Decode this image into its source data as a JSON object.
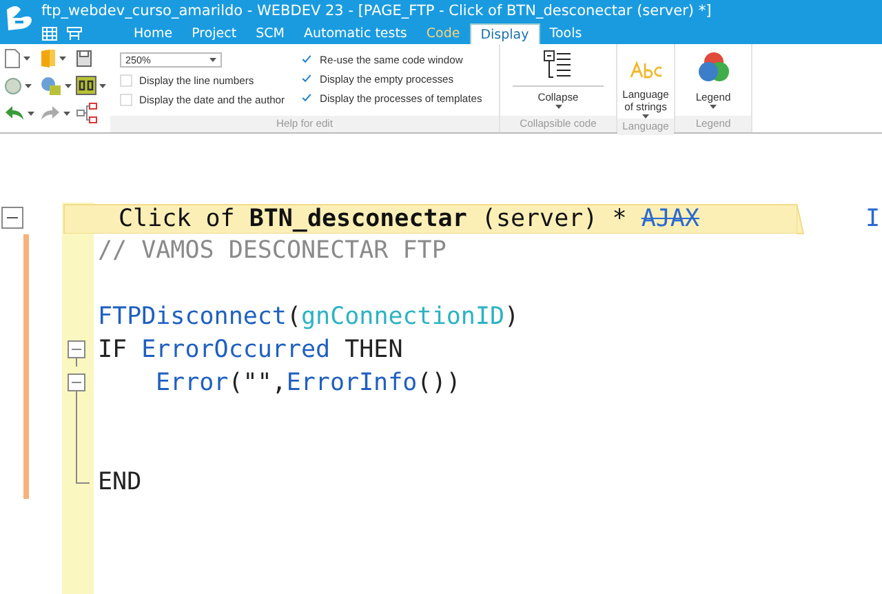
{
  "window": {
    "title": "ftp_webdev_curso_amarildo - WEBDEV 23 - [PAGE_FTP - Click of BTN_desconectar (server) *]"
  },
  "tabs": [
    {
      "label": "Home",
      "selected": false,
      "kind": "plain"
    },
    {
      "label": "Project",
      "selected": false,
      "kind": "plain"
    },
    {
      "label": "SCM",
      "selected": false,
      "kind": "plain"
    },
    {
      "label": "Automatic tests",
      "selected": false,
      "kind": "plain"
    },
    {
      "label": "Code",
      "selected": false,
      "kind": "context"
    },
    {
      "label": "Display",
      "selected": true,
      "kind": "plain"
    },
    {
      "label": "Tools",
      "selected": false,
      "kind": "plain"
    }
  ],
  "ribbon": {
    "zoom": "250%",
    "options_left": [
      {
        "label": "Display the line numbers",
        "checked": false
      },
      {
        "label": "Display the date and the author",
        "checked": false
      }
    ],
    "options_right": [
      {
        "label": "Re-use the same code window",
        "checked": true
      },
      {
        "label": "Display the empty processes",
        "checked": true
      },
      {
        "label": "Display the processes of templates",
        "checked": true
      }
    ],
    "help_group": "Help for edit",
    "groups": [
      {
        "kind": "collapse",
        "button": "Collapse",
        "label": "Collapsible code"
      },
      {
        "kind": "language",
        "button": "Language of strings",
        "label": "Language"
      },
      {
        "kind": "legend",
        "button": "Legend",
        "label": "Legend"
      }
    ]
  },
  "editor": {
    "header": {
      "title": "Click of **BTN_desconectar** (server) *",
      "tag": "AJAX",
      "next": "I"
    },
    "lines": [
      {
        "kind": "code",
        "modified": true,
        "tokens": [
          {
            "kind": "comment",
            "text": "// VAMOS DESCONECTAR FTP"
          }
        ]
      },
      {
        "kind": "code",
        "modified": true
      },
      {
        "kind": "code",
        "modified": true,
        "tokens": [
          {
            "kind": "function",
            "text": "FTPDisconnect"
          },
          {
            "kind": "plain",
            "text": "("
          },
          {
            "kind": "variable",
            "text": "gnConnectionID"
          },
          {
            "kind": "plain",
            "text": ")"
          }
        ]
      },
      {
        "kind": "block_start",
        "modified": true,
        "tokens": [
          {
            "kind": "keyword",
            "text": "IF "
          },
          {
            "kind": "function",
            "text": "ErrorOccurred"
          },
          {
            "kind": "keyword",
            "text": " THEN"
          }
        ],
        "children": [
          {
            "kind": "block_start",
            "modified": true,
            "tokens": [
              {
                "kind": "function",
                "text": "Error"
              },
              {
                "kind": "plain",
                "text": "(\"\","
              },
              {
                "kind": "function",
                "text": "ErrorInfo"
              },
              {
                "kind": "plain",
                "text": "())"
              }
            ]
          }
        ]
      },
      {
        "kind": "block_line",
        "modified": true
      },
      {
        "kind": "block_line",
        "modified": true
      },
      {
        "kind": "block_end",
        "modified": true,
        "tokens": [
          {
            "kind": "keyword",
            "text": "END"
          }
        ]
      }
    ]
  }
}
